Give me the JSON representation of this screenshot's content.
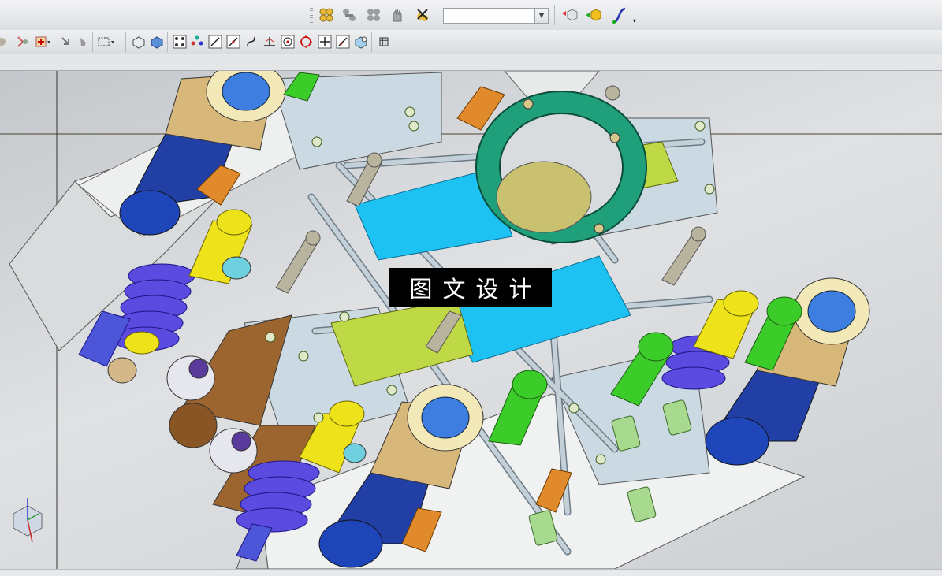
{
  "toolbar_top": {
    "icons": [
      "assembly-icon",
      "component-icon",
      "component-array-icon",
      "hand-grab-icon",
      "delete-component-icon",
      "model-view-icon",
      "shaded-view-icon",
      "curve-tool-icon"
    ],
    "combo_value": ""
  },
  "toolbar_second": {
    "icons": [
      "snap-icon",
      "select-filter-icon",
      "point-snap-icon",
      "arrow-icon",
      "box-select-icon",
      "wireframe-icon",
      "solid-icon",
      "select-all-icon",
      "points-icon",
      "line-icon",
      "slash-icon",
      "arc-icon",
      "perpendicular-icon",
      "center-icon",
      "circle-icon",
      "plus-icon",
      "tangent-icon",
      "view-icon",
      "grid-icon"
    ]
  },
  "watermark": {
    "text": "图文设计"
  },
  "colors": {
    "mold_plate": "#eceeee",
    "cylinder_blue": "#2a4fb8",
    "cylinder_tan": "#d8b77a",
    "spring_purple": "#5b4be0",
    "ring_teal": "#1fa37c",
    "plate_cyan": "#18bff0",
    "bolt_green": "#3ccc2a",
    "pin_yellow": "#eee21a",
    "frame_grey": "#c8d7e0"
  }
}
